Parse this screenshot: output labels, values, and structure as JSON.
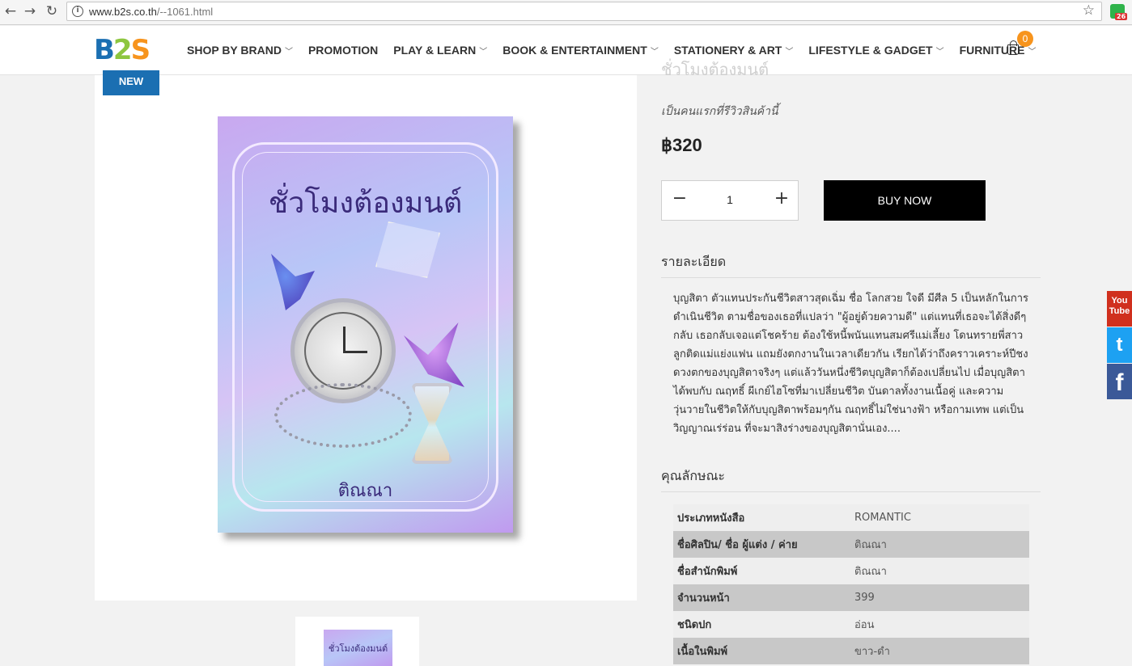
{
  "browser": {
    "url_host": "www.b2s.co.th",
    "url_path": "/--1061.html",
    "back_icon": "←",
    "forward_icon": "→",
    "reload_icon": "↻",
    "info_icon": "i",
    "star_icon": "☆",
    "extension_badge": "26"
  },
  "header": {
    "logo": {
      "b": "B",
      "two": "2",
      "s": "S"
    },
    "menu": [
      {
        "label": "SHOP BY BRAND",
        "chevron": "﹀"
      },
      {
        "label": "PROMOTION",
        "chevron": ""
      },
      {
        "label": "PLAY & LEARN",
        "chevron": "﹀"
      },
      {
        "label": "BOOK & ENTERTAINMENT",
        "chevron": "﹀"
      },
      {
        "label": "STATIONERY & ART",
        "chevron": "﹀"
      },
      {
        "label": "LIFESTYLE & GADGET",
        "chevron": "﹀"
      },
      {
        "label": "FURNITURE",
        "chevron": "﹀"
      }
    ],
    "cart_count": "0"
  },
  "product": {
    "badge": "NEW",
    "title_cut": "ชั่วโมงต้องมนต์",
    "cover_title": "ชั่วโมงต้องมนต์",
    "cover_author": "ติณณา",
    "review_link": "เป็นคนแรกที่รีวิวสินค้านี้",
    "price": "฿320",
    "qty": "1",
    "qty_minus": "−",
    "qty_plus": "+",
    "buy_label": "BUY NOW"
  },
  "details": {
    "heading": "รายละเอียด",
    "text": "บุญสิตา ตัวแทนประกันชีวิตสาวสุดเฉิ่ม ชื่อ โลกสวย ใจดี มีศีล 5 เป็นหลักในการดำเนินชีวิต ตามชื่อของเธอที่แปลว่า \"ผู้อยู่ด้วยความดี\" แต่แทนที่เธอจะได้สิ่งดีๆกลับ เธอกลับเจอแต่โชคร้าย ต้องใช้หนี้พนันแทนสมศรีแม่เลี้ยง โดนทรายพี่สาวลูกติดแม่แย่งแฟน แถมยังตกงานในเวลาเดียวกัน เรียกได้ว่าถึงคราวเคราะห์ปีชงดวงตกของบุญสิตาจริงๆ แต่แล้ววันหนึ่งชีวิตบุญสิตาก็ต้องเปลี่ยนไป เมื่อบุญสิตาได้พบกับ ณฤทธิ์ ผีเกย์ไฮโซที่มาเปลี่ยนชีวิต บันดาลทั้งงานเนื้อคู่ และความวุ่นวายในชีวิตให้กับบุญสิตาพร้อมๆกัน ณฤทธิ์ไม่ใช่นางฟ้า หรือกามเทพ แต่เป็นวิญญาณเร่ร่อน ที่จะมาสิงร่างของบุญสิตานั่นเอง...."
  },
  "features": {
    "heading": "คุณลักษณะ",
    "rows": [
      {
        "key": "ประเภทหนังสือ",
        "value": "ROMANTIC"
      },
      {
        "key": "ชื่อศิลปิน/ ชื่อ ผู้แต่ง / ค่าย",
        "value": "ติณณา"
      },
      {
        "key": "ชื่อสำนักพิมพ์",
        "value": "ติณณา"
      },
      {
        "key": "จำนวนหน้า",
        "value": "399"
      },
      {
        "key": "ชนิดปก",
        "value": "อ่อน"
      },
      {
        "key": "เนื้อในพิมพ์",
        "value": "ขาว-ดำ"
      }
    ]
  },
  "social": {
    "youtube": "You Tube",
    "twitter": "t",
    "facebook": "f"
  },
  "colors": {
    "brand_blue": "#1b6fb2",
    "brand_green": "#8dc63f",
    "brand_orange": "#f7941d",
    "buy_button": "#000000"
  }
}
